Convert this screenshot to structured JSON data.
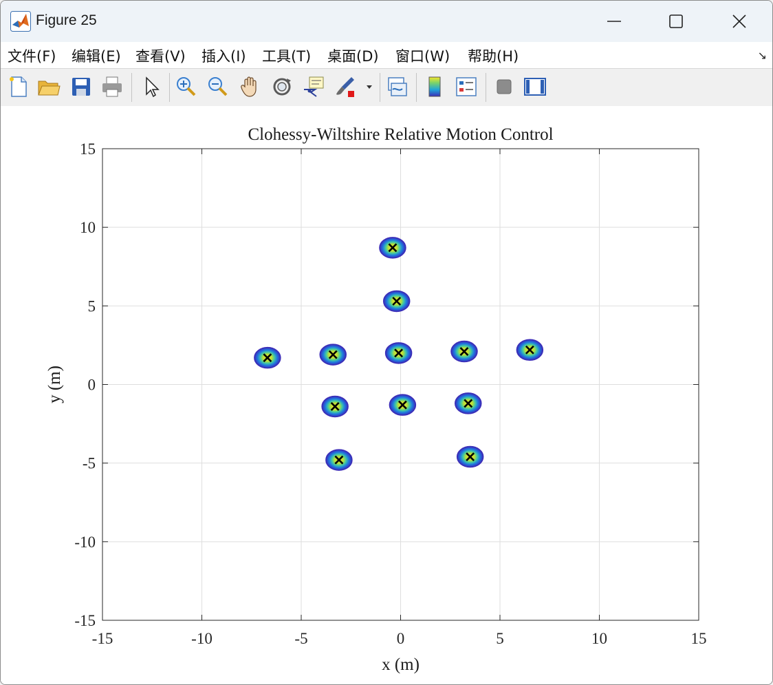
{
  "window": {
    "title": "Figure 25",
    "icon": "matlab-logo-icon",
    "controls": [
      "minimize-icon",
      "maximize-icon",
      "close-icon"
    ]
  },
  "menu": {
    "items": [
      "文件(F)",
      "编辑(E)",
      "查看(V)",
      "插入(I)",
      "工具(T)",
      "桌面(D)",
      "窗口(W)",
      "帮助(H)"
    ],
    "dock_arrow": "↘"
  },
  "toolbar": {
    "buttons": [
      {
        "name": "new-figure-icon"
      },
      {
        "name": "open-file-icon"
      },
      {
        "name": "save-icon"
      },
      {
        "name": "print-icon"
      },
      {
        "name": "edit-plot-arrow-icon"
      },
      {
        "name": "zoom-in-icon"
      },
      {
        "name": "zoom-out-icon"
      },
      {
        "name": "pan-hand-icon"
      },
      {
        "name": "rotate-3d-icon"
      },
      {
        "name": "data-cursor-icon"
      },
      {
        "name": "brush-icon"
      },
      {
        "name": "brush-dropdown-icon"
      },
      {
        "name": "link-plot-icon"
      },
      {
        "name": "colorbar-icon"
      },
      {
        "name": "legend-icon"
      },
      {
        "name": "hide-plot-tools-icon"
      },
      {
        "name": "show-plot-tools-icon"
      }
    ]
  },
  "chart_data": {
    "type": "scatter",
    "title": "Clohessy-Wiltshire Relative Motion Control",
    "xlabel": "x (m)",
    "ylabel": "y (m)",
    "xlim": [
      -15,
      15
    ],
    "ylim": [
      -15,
      15
    ],
    "xticks": [
      -15,
      -10,
      -5,
      0,
      5,
      10,
      15
    ],
    "yticks": [
      -15,
      -10,
      -5,
      0,
      5,
      10,
      15
    ],
    "grid": true,
    "marker": "x",
    "marker_color": "#000000",
    "cluster_colors": [
      "#3b2cb8",
      "#1f78e0",
      "#18b7c8",
      "#6fdc5e",
      "#f6e62a"
    ],
    "points": [
      {
        "x": -0.4,
        "y": 8.7
      },
      {
        "x": -0.2,
        "y": 5.3
      },
      {
        "x": -6.7,
        "y": 1.7
      },
      {
        "x": -3.4,
        "y": 1.9
      },
      {
        "x": -0.1,
        "y": 2.0
      },
      {
        "x": 3.2,
        "y": 2.1
      },
      {
        "x": 6.5,
        "y": 2.2
      },
      {
        "x": -3.3,
        "y": -1.4
      },
      {
        "x": 0.1,
        "y": -1.3
      },
      {
        "x": 3.4,
        "y": -1.2
      },
      {
        "x": -3.1,
        "y": -4.8
      },
      {
        "x": 3.5,
        "y": -4.6
      }
    ]
  }
}
